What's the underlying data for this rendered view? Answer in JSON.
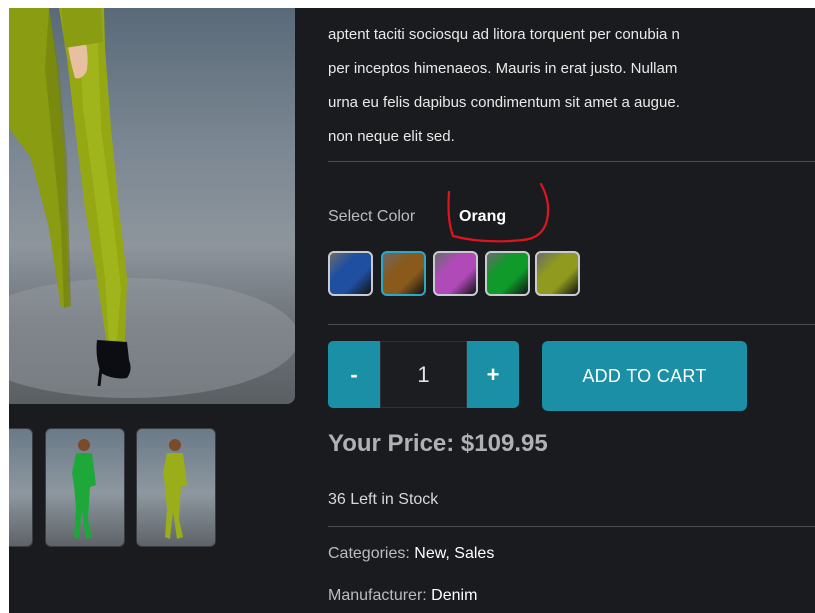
{
  "description": {
    "lines": [
      "aptent taciti sociosqu ad litora torquent per conubia n",
      "per inceptos himenaeos. Mauris in erat justo. Nullam",
      "urna eu felis dapibus condimentum sit amet a augue.",
      "non neque elit sed."
    ]
  },
  "color_selector": {
    "label": "Select Color",
    "selected_value": "Orang",
    "swatches": [
      {
        "name": "blue",
        "color": "#1f4fa1"
      },
      {
        "name": "brown",
        "color": "#8a5a1c"
      },
      {
        "name": "purple",
        "color": "#b04ab8"
      },
      {
        "name": "green",
        "color": "#0f9a2a"
      },
      {
        "name": "olive",
        "color": "#8f9a1e"
      }
    ]
  },
  "quantity": {
    "minus_label": "-",
    "value": "1",
    "plus_label": "+"
  },
  "cart": {
    "add_label": "ADD TO CART"
  },
  "price": {
    "text": "Your Price: $109.95"
  },
  "stock": {
    "text": "36 Left in Stock"
  },
  "categories": {
    "label": "Categories:",
    "value": "New, Sales"
  },
  "manufacturer": {
    "label": "Manufacturer:",
    "value": "Denim"
  },
  "colors": {
    "accent": "#1a8fa5",
    "background": "#1a1b1e",
    "annotation": "#e0141e"
  }
}
